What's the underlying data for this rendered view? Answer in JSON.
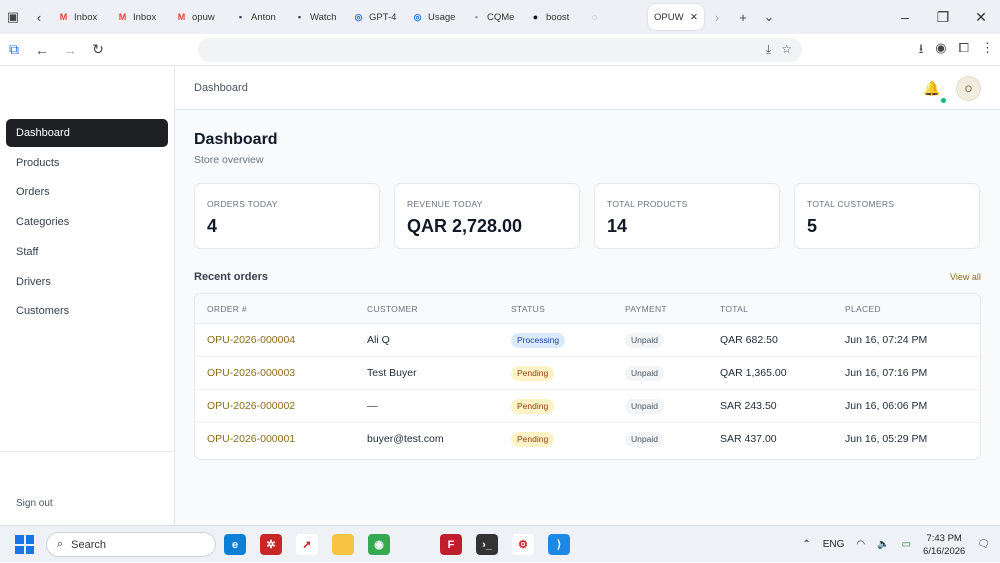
{
  "browser": {
    "tabs": [
      {
        "label": "Inbox",
        "icon": "gmail-icon",
        "color": "#ea4335"
      },
      {
        "label": "Inbox",
        "icon": "gmail-icon",
        "color": "#ea4335"
      },
      {
        "label": "opuw",
        "icon": "gmail-icon",
        "color": "#ea4335"
      },
      {
        "label": "Anton",
        "icon": "app-icon",
        "color": "#2d3e50"
      },
      {
        "label": "Watch",
        "icon": "app-icon",
        "color": "#2d3e50"
      },
      {
        "label": "GPT-4",
        "icon": "globe-icon",
        "color": "#1a73e8"
      },
      {
        "label": "Usage",
        "icon": "globe-icon",
        "color": "#1a73e8"
      },
      {
        "label": "CQMe",
        "icon": "page-icon",
        "color": "#999999"
      },
      {
        "label": "boost",
        "icon": "github-icon",
        "color": "#111111"
      },
      {
        "label": "",
        "icon": "loading-icon",
        "color": "#555555"
      }
    ],
    "active_tab": {
      "label": "OPUW"
    }
  },
  "sidebar": {
    "items": [
      {
        "label": "Dashboard",
        "active": true
      },
      {
        "label": "Products",
        "active": false
      },
      {
        "label": "Orders",
        "active": false
      },
      {
        "label": "Categories",
        "active": false
      },
      {
        "label": "Staff",
        "active": false
      },
      {
        "label": "Drivers",
        "active": false
      },
      {
        "label": "Customers",
        "active": false
      }
    ],
    "sign_out": "Sign out"
  },
  "header": {
    "breadcrumb": "Dashboard",
    "avatar_initial": "O"
  },
  "page": {
    "title": "Dashboard",
    "subtitle": "Store overview"
  },
  "stats": [
    {
      "label": "ORDERS TODAY",
      "value": "4"
    },
    {
      "label": "REVENUE TODAY",
      "value": "QAR 2,728.00"
    },
    {
      "label": "TOTAL PRODUCTS",
      "value": "14"
    },
    {
      "label": "TOTAL CUSTOMERS",
      "value": "5"
    }
  ],
  "recent_orders": {
    "title": "Recent orders",
    "view_all": "View all",
    "columns": [
      "ORDER #",
      "CUSTOMER",
      "STATUS",
      "PAYMENT",
      "TOTAL",
      "PLACED"
    ],
    "rows": [
      {
        "order": "OPU-2026-000004",
        "customer": "Ali Q",
        "status": "Processing",
        "status_kind": "processing",
        "payment": "Unpaid",
        "total": "QAR 682.50",
        "placed": "Jun 16, 07:24 PM"
      },
      {
        "order": "OPU-2026-000003",
        "customer": "Test Buyer",
        "status": "Pending",
        "status_kind": "pending",
        "payment": "Unpaid",
        "total": "QAR 1,365.00",
        "placed": "Jun 16, 07:16 PM"
      },
      {
        "order": "OPU-2026-000002",
        "customer": "—",
        "status": "Pending",
        "status_kind": "pending",
        "payment": "Unpaid",
        "total": "SAR 243.50",
        "placed": "Jun 16, 06:06 PM"
      },
      {
        "order": "OPU-2026-000001",
        "customer": "buyer@test.com",
        "status": "Pending",
        "status_kind": "pending",
        "payment": "Unpaid",
        "total": "SAR 437.00",
        "placed": "Jun 16, 05:29 PM"
      }
    ]
  },
  "taskbar": {
    "search": "Search",
    "language": "ENG",
    "time": "7:43 PM",
    "date": "6/16/2026"
  },
  "colors": {
    "accent_link": "#8a6d1e",
    "nav_active_bg": "#1f2023",
    "processing_bg": "#dbeafe",
    "pending_bg": "#fef3c7"
  }
}
